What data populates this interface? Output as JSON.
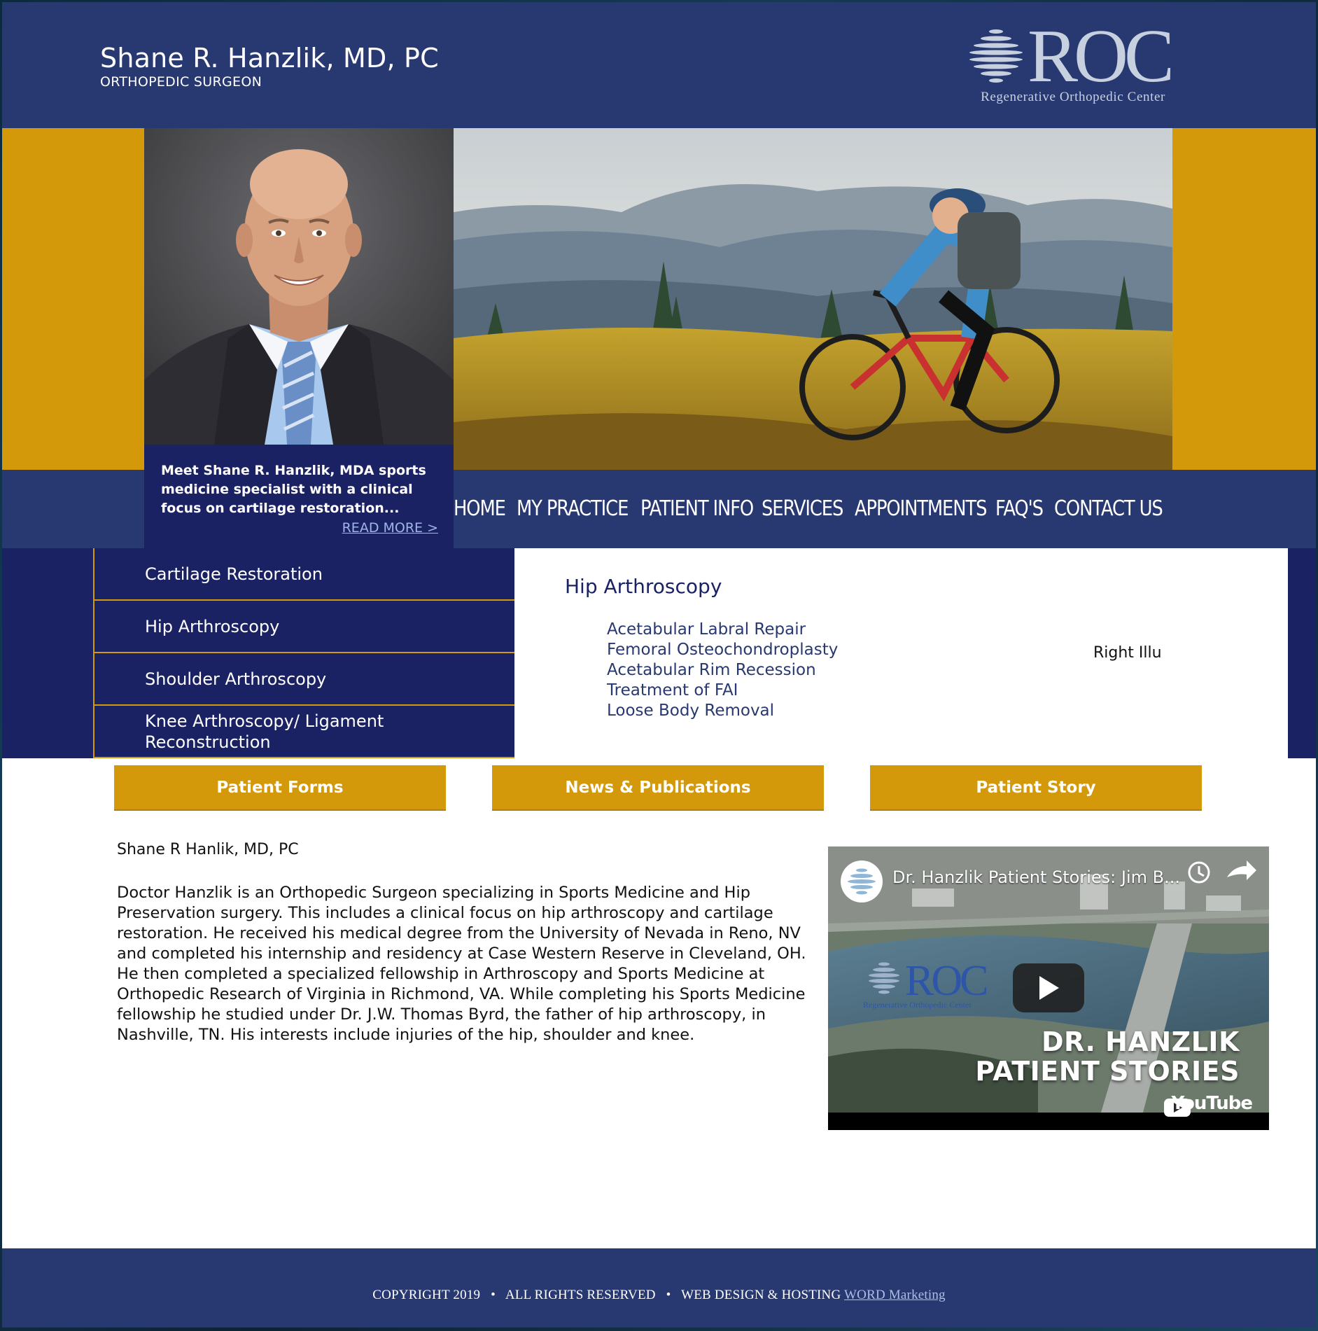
{
  "header": {
    "title": "Shane R. Hanzlik, MD, PC",
    "subtitle": "ORTHOPEDIC SURGEON",
    "logo_text": "ROC",
    "logo_sub": "Regenerative Orthopedic Center"
  },
  "hero": {
    "caption": "Meet Shane R. Hanzlik, MDA sports medicine specialist with a clinical focus on cartilage restoration...",
    "read_more": "READ MORE >"
  },
  "nav": {
    "items": [
      "HOME",
      "MY PRACTICE",
      "PATIENT INFO",
      "SERVICES",
      "APPOINTMENTS",
      "FAQ'S",
      "CONTACT US"
    ]
  },
  "side_menu": {
    "items": [
      "Cartilage Restoration",
      "Hip Arthroscopy",
      "Shoulder Arthroscopy",
      "Knee Arthroscopy/ Ligament Reconstruction"
    ]
  },
  "panel": {
    "title": "Hip Arthroscopy",
    "list": [
      "Acetabular Labral Repair",
      "Femoral Osteochondroplasty",
      "Acetabular Rim Recession",
      "Treatment of FAI",
      "Loose Body Removal"
    ],
    "right_illu": "Right Illu"
  },
  "buttons": {
    "patient_forms": "Patient Forms",
    "news": "News & Publications",
    "patient_story": "Patient Story"
  },
  "about": {
    "name": "Shane R Hanlik, MD, PC",
    "body": "Doctor Hanzlik is an Orthopedic Surgeon specializing in Sports Medicine and Hip Preservation surgery. This includes a clinical focus on hip arthroscopy and cartilage restoration. He received his medical degree from the University of Nevada in Reno, NV and completed his internship and residency at Case Western Reserve in Cleveland, OH. He then completed a specialized fellowship in Arthroscopy and Sports Medicine at Orthopedic Research of Virginia in Richmond, VA. While completing his Sports Medicine fellowship he studied under Dr. J.W. Thomas Byrd, the father of hip arthroscopy, in Nashville, TN. His interests include injuries of the hip, shoulder and knee."
  },
  "video": {
    "title": "Dr. Hanzlik Patient Stories: Jim B...",
    "logo_text": "ROC",
    "logo_sub": "Regenerative Orthopedic Center",
    "headline_1": "DR.  HANZLIK",
    "headline_2": "PATIENT  STORIES",
    "brand": "YouTube"
  },
  "footer": {
    "copyright": "COPYRIGHT 2019",
    "rights": "ALL RIGHTS RESERVED",
    "design": "WEB DESIGN & HOSTING",
    "link": "WORD Marketing"
  },
  "colors": {
    "navy": "#283870",
    "deep_navy": "#1b2263",
    "gold": "#d4990a"
  }
}
